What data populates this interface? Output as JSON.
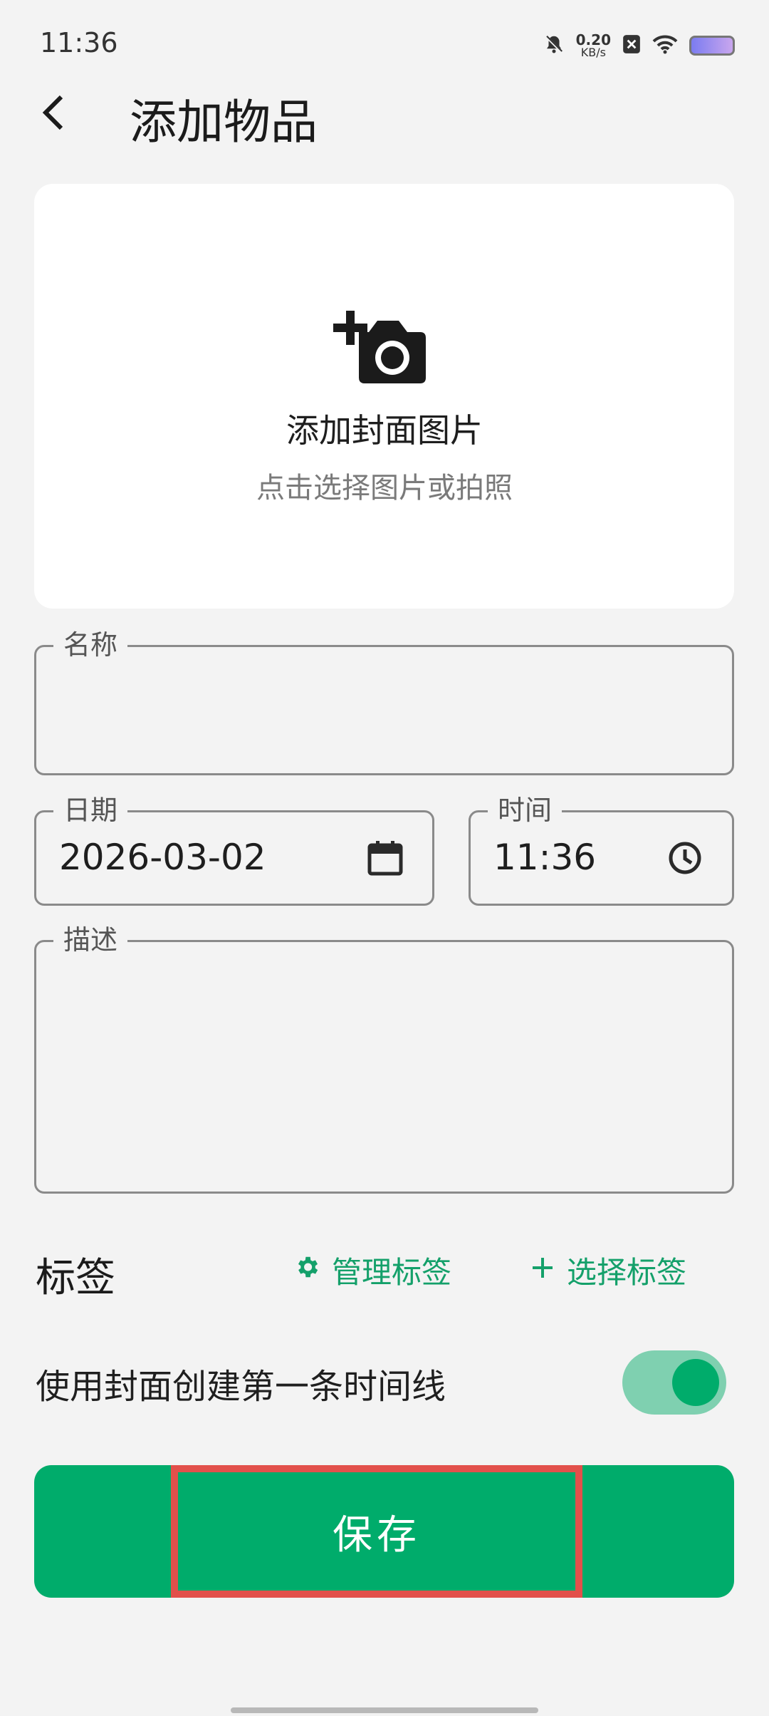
{
  "status_bar": {
    "time": "11:36",
    "net_speed_value": "0.20",
    "net_speed_unit": "KB/s",
    "icons": [
      "mute-bell-icon",
      "close-badge-icon",
      "wifi-icon",
      "battery-icon"
    ]
  },
  "header": {
    "title": "添加物品",
    "back_icon": "chevron-left-icon"
  },
  "cover": {
    "icon": "add-camera-icon",
    "title": "添加封面图片",
    "subtitle": "点击选择图片或拍照"
  },
  "form": {
    "name": {
      "label": "名称",
      "value": ""
    },
    "date": {
      "label": "日期",
      "value": "2026-03-02",
      "icon": "calendar-icon"
    },
    "time": {
      "label": "时间",
      "value": "11:36",
      "icon": "clock-icon"
    },
    "description": {
      "label": "描述",
      "value": ""
    }
  },
  "tags": {
    "title": "标签",
    "manage_label": "管理标签",
    "manage_icon": "gear-icon",
    "select_label": "选择标签",
    "select_icon": "plus-icon"
  },
  "timeline_option": {
    "label": "使用封面创建第一条时间线",
    "enabled": true
  },
  "save_button": {
    "label": "保存"
  },
  "colors": {
    "accent": "#00AC6B",
    "accent_light": "#7FD0B0",
    "highlight_border": "#E2504B",
    "background": "#F3F3F3"
  }
}
